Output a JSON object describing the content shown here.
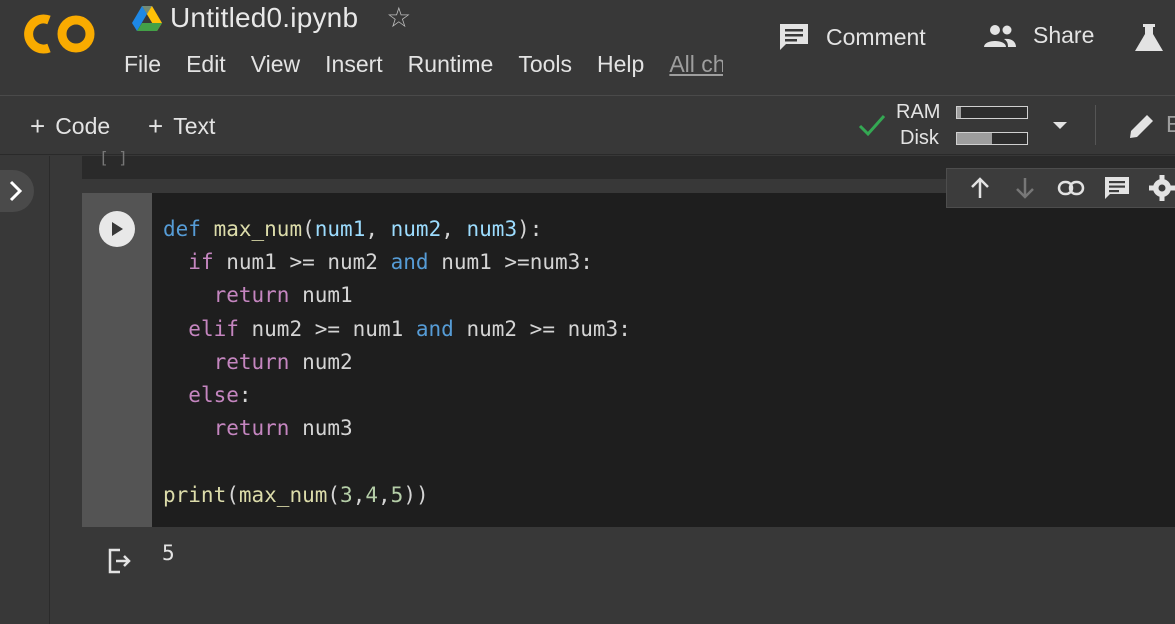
{
  "header": {
    "logo_text": "CO",
    "notebook_title": "Untitled0.ipynb",
    "menu": [
      "File",
      "Edit",
      "View",
      "Insert",
      "Runtime",
      "Tools",
      "Help",
      "All ch"
    ],
    "comment_label": "Comment",
    "share_label": "Share"
  },
  "toolbar": {
    "add_code_label": "Code",
    "add_text_label": "Text",
    "ram_label": "RAM",
    "disk_label": "Disk",
    "ram_usage": 0.05,
    "disk_usage": 0.5,
    "edit_label": "E"
  },
  "prev_cell": {
    "bracket_text": "[ ]"
  },
  "code_cell": {
    "lines": [
      "def max_num(num1, num2, num3):",
      "  if num1 >= num2 and num1 >=num3:",
      "    return num1",
      "  elif num2 >= num1 and num2 >= num3:",
      "    return num2",
      "  else:",
      "    return num3",
      "",
      "print(max_num(3,4,5))"
    ],
    "output": "5"
  },
  "colors": {
    "background": "#383838",
    "editor_bg": "#1e1e1e",
    "keyword": "#569cd6",
    "control": "#c586c0",
    "function": "#dcdcaa",
    "param": "#9cdcfe",
    "number": "#b5cea8",
    "logo_orange": "#f9ab00",
    "status_green": "#34a853"
  }
}
